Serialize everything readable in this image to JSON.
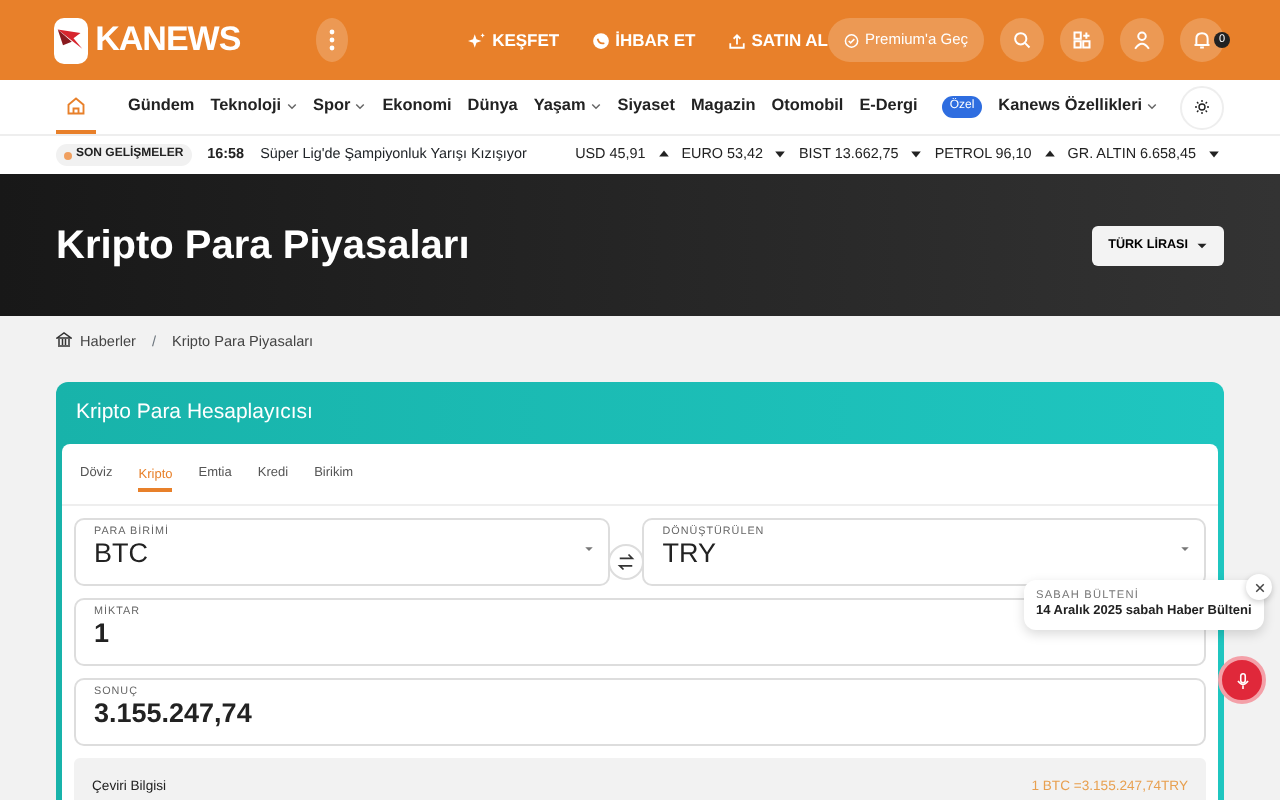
{
  "header": {
    "logo": "KANEWS",
    "links": [
      {
        "label": "KEŞFET"
      },
      {
        "label": "İHBAR ET"
      },
      {
        "label": "SATIN AL"
      }
    ],
    "premium": "Premium'a Geç",
    "notification_count": "0"
  },
  "nav": {
    "items": [
      {
        "label": "Gündem",
        "dropdown": false
      },
      {
        "label": "Teknoloji",
        "dropdown": true
      },
      {
        "label": "Spor",
        "dropdown": true
      },
      {
        "label": "Ekonomi",
        "dropdown": false
      },
      {
        "label": "Dünya",
        "dropdown": false
      },
      {
        "label": "Yaşam",
        "dropdown": true
      },
      {
        "label": "Siyaset",
        "dropdown": false
      },
      {
        "label": "Magazin",
        "dropdown": false
      },
      {
        "label": "Otomobil",
        "dropdown": false
      },
      {
        "label": "E-Dergi",
        "dropdown": false,
        "badge": "Özel"
      },
      {
        "label": "Kanews Özellikleri",
        "dropdown": true
      }
    ],
    "home_selected": true
  },
  "ticker": {
    "label": "SON GELİŞMELER",
    "time": "16:58",
    "headline": "Süper Lig'de Şampiyonluk Yarışı Kızışıyor",
    "markets": [
      {
        "name": "USD",
        "value": "45,91",
        "rising": true
      },
      {
        "name": "EURO",
        "value": "53,42",
        "rising": false
      },
      {
        "name": "BIST",
        "value": "13.662,75",
        "rising": false
      },
      {
        "name": "PETROL",
        "value": "96,10",
        "rising": true
      },
      {
        "name": "GR. ALTIN",
        "value": "6.658,45",
        "rising": false
      }
    ]
  },
  "hero": {
    "title": "Kripto Para Piyasaları",
    "currency_button": "TÜRK LİRASI"
  },
  "breadcrumb": [
    "Haberler",
    "Kripto Para Piyasaları"
  ],
  "breadcrumb_separator": "/",
  "calculator": {
    "title": "Kripto Para Hesaplayıcısı",
    "tabs": [
      {
        "label": "Döviz",
        "selected": false
      },
      {
        "label": "Kripto",
        "selected": true
      },
      {
        "label": "Emtia",
        "selected": false
      },
      {
        "label": "Kredi",
        "selected": false
      },
      {
        "label": "Birikim",
        "selected": false
      }
    ],
    "from": {
      "label": "PARA BİRİMİ",
      "value": "BTC"
    },
    "to": {
      "label": "DÖNÜŞTÜRÜLEN",
      "value": "TRY"
    },
    "amount": {
      "label": "MİKTAR",
      "value": "1"
    },
    "result": {
      "label": "SONUÇ",
      "value": "3.155.247,74"
    },
    "info_title": "Çeviri Bilgisi",
    "info_rate": "1 BTC =3.155.247,74TRY"
  },
  "toast": {
    "kicker": "SABAH BÜLTENİ",
    "text": "14 Aralık 2025 sabah Haber Bülteni"
  }
}
